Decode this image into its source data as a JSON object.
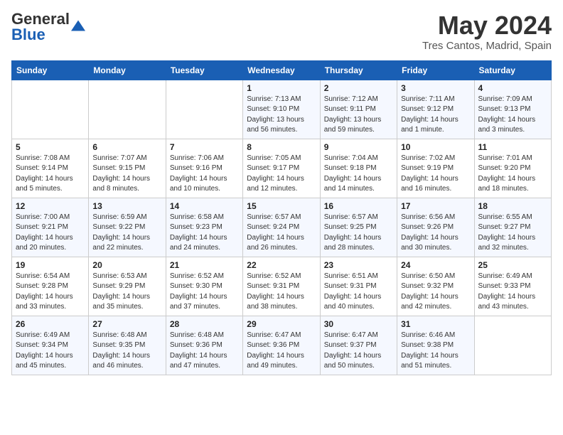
{
  "header": {
    "logo_general": "General",
    "logo_blue": "Blue",
    "month_year": "May 2024",
    "location": "Tres Cantos, Madrid, Spain"
  },
  "weekdays": [
    "Sunday",
    "Monday",
    "Tuesday",
    "Wednesday",
    "Thursday",
    "Friday",
    "Saturday"
  ],
  "weeks": [
    [
      {
        "day": "",
        "info": ""
      },
      {
        "day": "",
        "info": ""
      },
      {
        "day": "",
        "info": ""
      },
      {
        "day": "1",
        "info": "Sunrise: 7:13 AM\nSunset: 9:10 PM\nDaylight: 13 hours\nand 56 minutes."
      },
      {
        "day": "2",
        "info": "Sunrise: 7:12 AM\nSunset: 9:11 PM\nDaylight: 13 hours\nand 59 minutes."
      },
      {
        "day": "3",
        "info": "Sunrise: 7:11 AM\nSunset: 9:12 PM\nDaylight: 14 hours\nand 1 minute."
      },
      {
        "day": "4",
        "info": "Sunrise: 7:09 AM\nSunset: 9:13 PM\nDaylight: 14 hours\nand 3 minutes."
      }
    ],
    [
      {
        "day": "5",
        "info": "Sunrise: 7:08 AM\nSunset: 9:14 PM\nDaylight: 14 hours\nand 5 minutes."
      },
      {
        "day": "6",
        "info": "Sunrise: 7:07 AM\nSunset: 9:15 PM\nDaylight: 14 hours\nand 8 minutes."
      },
      {
        "day": "7",
        "info": "Sunrise: 7:06 AM\nSunset: 9:16 PM\nDaylight: 14 hours\nand 10 minutes."
      },
      {
        "day": "8",
        "info": "Sunrise: 7:05 AM\nSunset: 9:17 PM\nDaylight: 14 hours\nand 12 minutes."
      },
      {
        "day": "9",
        "info": "Sunrise: 7:04 AM\nSunset: 9:18 PM\nDaylight: 14 hours\nand 14 minutes."
      },
      {
        "day": "10",
        "info": "Sunrise: 7:02 AM\nSunset: 9:19 PM\nDaylight: 14 hours\nand 16 minutes."
      },
      {
        "day": "11",
        "info": "Sunrise: 7:01 AM\nSunset: 9:20 PM\nDaylight: 14 hours\nand 18 minutes."
      }
    ],
    [
      {
        "day": "12",
        "info": "Sunrise: 7:00 AM\nSunset: 9:21 PM\nDaylight: 14 hours\nand 20 minutes."
      },
      {
        "day": "13",
        "info": "Sunrise: 6:59 AM\nSunset: 9:22 PM\nDaylight: 14 hours\nand 22 minutes."
      },
      {
        "day": "14",
        "info": "Sunrise: 6:58 AM\nSunset: 9:23 PM\nDaylight: 14 hours\nand 24 minutes."
      },
      {
        "day": "15",
        "info": "Sunrise: 6:57 AM\nSunset: 9:24 PM\nDaylight: 14 hours\nand 26 minutes."
      },
      {
        "day": "16",
        "info": "Sunrise: 6:57 AM\nSunset: 9:25 PM\nDaylight: 14 hours\nand 28 minutes."
      },
      {
        "day": "17",
        "info": "Sunrise: 6:56 AM\nSunset: 9:26 PM\nDaylight: 14 hours\nand 30 minutes."
      },
      {
        "day": "18",
        "info": "Sunrise: 6:55 AM\nSunset: 9:27 PM\nDaylight: 14 hours\nand 32 minutes."
      }
    ],
    [
      {
        "day": "19",
        "info": "Sunrise: 6:54 AM\nSunset: 9:28 PM\nDaylight: 14 hours\nand 33 minutes."
      },
      {
        "day": "20",
        "info": "Sunrise: 6:53 AM\nSunset: 9:29 PM\nDaylight: 14 hours\nand 35 minutes."
      },
      {
        "day": "21",
        "info": "Sunrise: 6:52 AM\nSunset: 9:30 PM\nDaylight: 14 hours\nand 37 minutes."
      },
      {
        "day": "22",
        "info": "Sunrise: 6:52 AM\nSunset: 9:31 PM\nDaylight: 14 hours\nand 38 minutes."
      },
      {
        "day": "23",
        "info": "Sunrise: 6:51 AM\nSunset: 9:31 PM\nDaylight: 14 hours\nand 40 minutes."
      },
      {
        "day": "24",
        "info": "Sunrise: 6:50 AM\nSunset: 9:32 PM\nDaylight: 14 hours\nand 42 minutes."
      },
      {
        "day": "25",
        "info": "Sunrise: 6:49 AM\nSunset: 9:33 PM\nDaylight: 14 hours\nand 43 minutes."
      }
    ],
    [
      {
        "day": "26",
        "info": "Sunrise: 6:49 AM\nSunset: 9:34 PM\nDaylight: 14 hours\nand 45 minutes."
      },
      {
        "day": "27",
        "info": "Sunrise: 6:48 AM\nSunset: 9:35 PM\nDaylight: 14 hours\nand 46 minutes."
      },
      {
        "day": "28",
        "info": "Sunrise: 6:48 AM\nSunset: 9:36 PM\nDaylight: 14 hours\nand 47 minutes."
      },
      {
        "day": "29",
        "info": "Sunrise: 6:47 AM\nSunset: 9:36 PM\nDaylight: 14 hours\nand 49 minutes."
      },
      {
        "day": "30",
        "info": "Sunrise: 6:47 AM\nSunset: 9:37 PM\nDaylight: 14 hours\nand 50 minutes."
      },
      {
        "day": "31",
        "info": "Sunrise: 6:46 AM\nSunset: 9:38 PM\nDaylight: 14 hours\nand 51 minutes."
      },
      {
        "day": "",
        "info": ""
      }
    ]
  ]
}
